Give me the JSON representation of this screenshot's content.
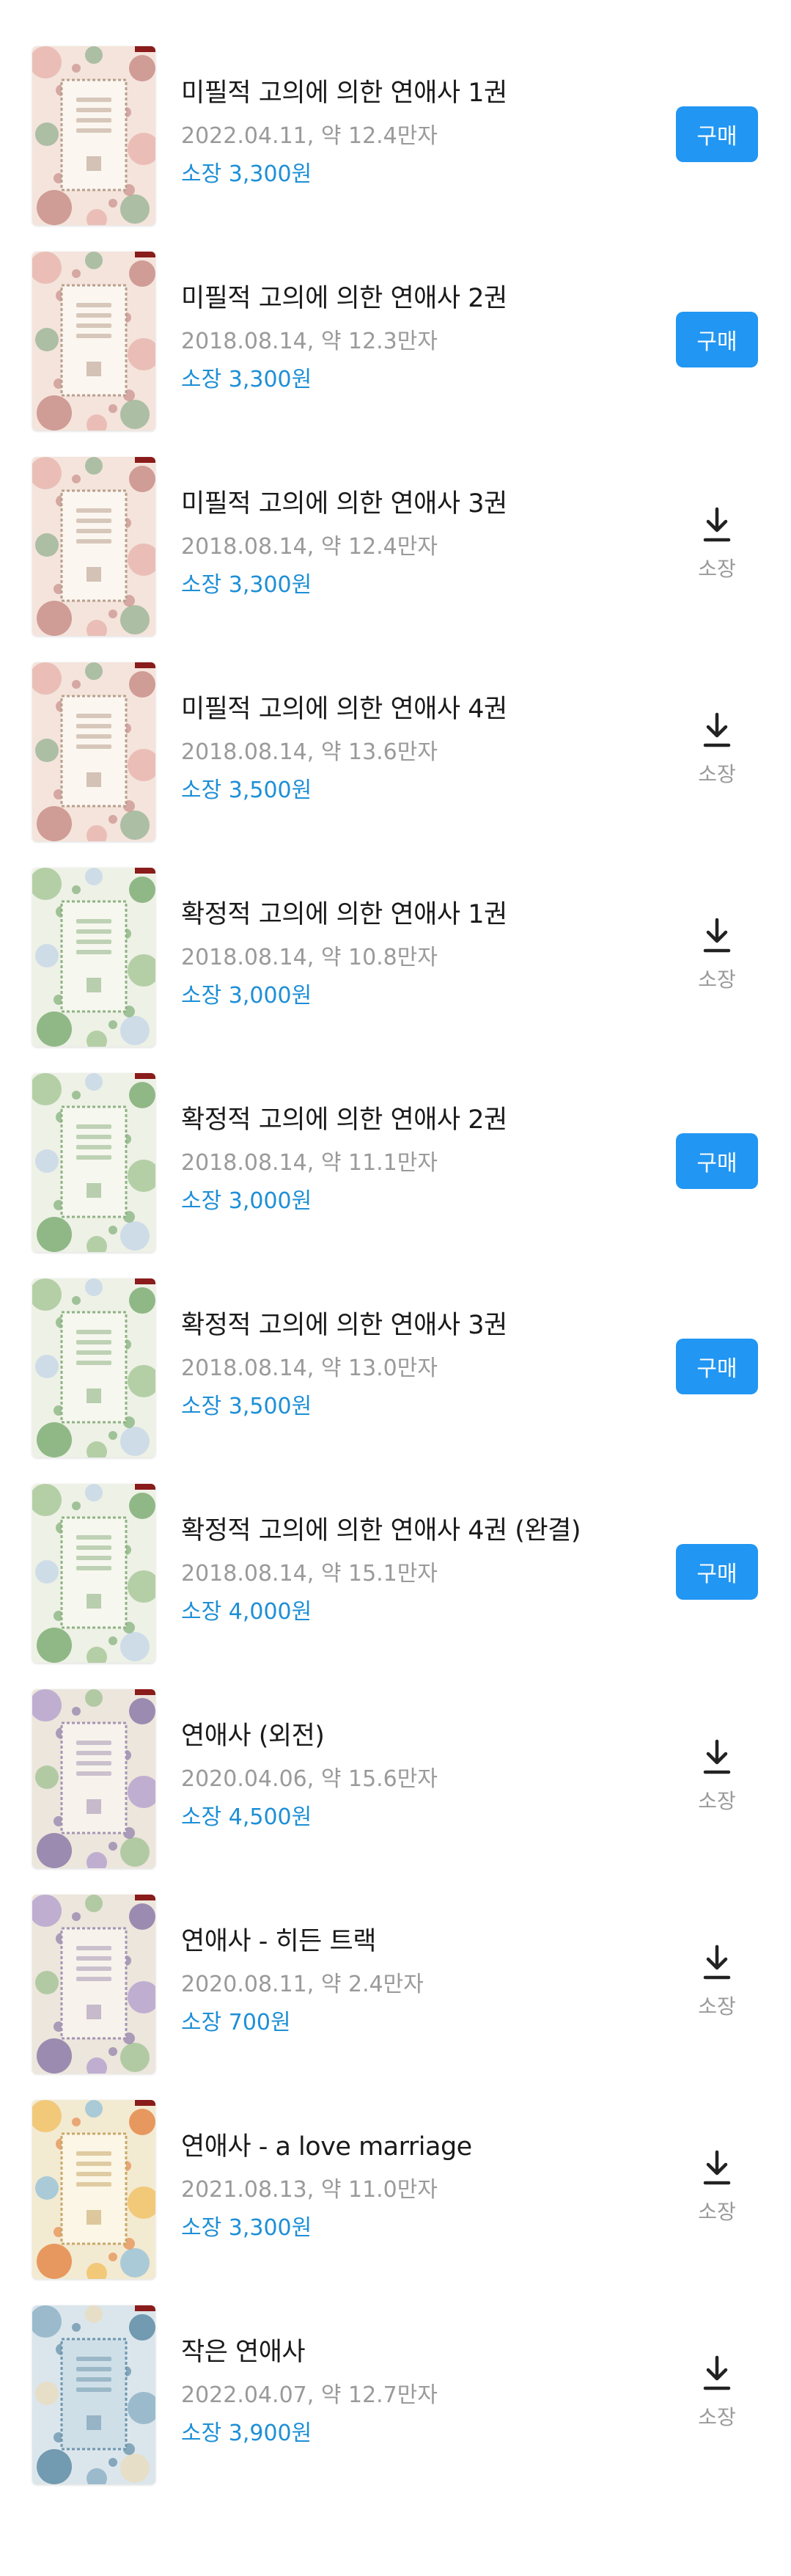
{
  "books": [
    {
      "title": "미필적 고의에 의한 연애사 1권",
      "meta": "2022.04.11, 약 12.4만자",
      "price": "소장 3,300원",
      "action": "buy",
      "cover": "pink"
    },
    {
      "title": "미필적 고의에 의한 연애사 2권",
      "meta": "2018.08.14, 약 12.3만자",
      "price": "소장 3,300원",
      "action": "buy",
      "cover": "pink"
    },
    {
      "title": "미필적 고의에 의한 연애사 3권",
      "meta": "2018.08.14, 약 12.4만자",
      "price": "소장 3,300원",
      "action": "owned",
      "cover": "pink"
    },
    {
      "title": "미필적 고의에 의한 연애사 4권",
      "meta": "2018.08.14, 약 13.6만자",
      "price": "소장 3,500원",
      "action": "owned",
      "cover": "pink"
    },
    {
      "title": "확정적 고의에 의한 연애사 1권",
      "meta": "2018.08.14, 약 10.8만자",
      "price": "소장 3,000원",
      "action": "owned",
      "cover": "green"
    },
    {
      "title": "확정적 고의에 의한 연애사 2권",
      "meta": "2018.08.14, 약 11.1만자",
      "price": "소장 3,000원",
      "action": "buy",
      "cover": "green"
    },
    {
      "title": "확정적 고의에 의한 연애사 3권",
      "meta": "2018.08.14, 약 13.0만자",
      "price": "소장 3,500원",
      "action": "buy",
      "cover": "green"
    },
    {
      "title": "확정적 고의에 의한 연애사 4권 (완결)",
      "meta": "2018.08.14, 약 15.1만자",
      "price": "소장 4,000원",
      "action": "buy",
      "cover": "green"
    },
    {
      "title": "연애사 (외전)",
      "meta": "2020.04.06, 약 15.6만자",
      "price": "소장 4,500원",
      "action": "owned",
      "cover": "lilac"
    },
    {
      "title": "연애사 - 히든 트랙",
      "meta": "2020.08.11, 약 2.4만자",
      "price": "소장 700원",
      "action": "owned",
      "cover": "lilac"
    },
    {
      "title": "연애사 - a love marriage",
      "meta": "2021.08.13, 약 11.0만자",
      "price": "소장 3,300원",
      "action": "owned",
      "cover": "yellow"
    },
    {
      "title": "작은 연애사",
      "meta": "2022.04.07, 약 12.7만자",
      "price": "소장 3,900원",
      "action": "owned",
      "cover": "blue"
    }
  ],
  "labels": {
    "buy": "구매",
    "owned": "소장"
  },
  "icons": {
    "download": "download-icon"
  },
  "colors": {
    "accent": "#2196f3",
    "price": "#1e8fd6",
    "meta": "#9a9a9a",
    "title": "#1a1a1a"
  }
}
